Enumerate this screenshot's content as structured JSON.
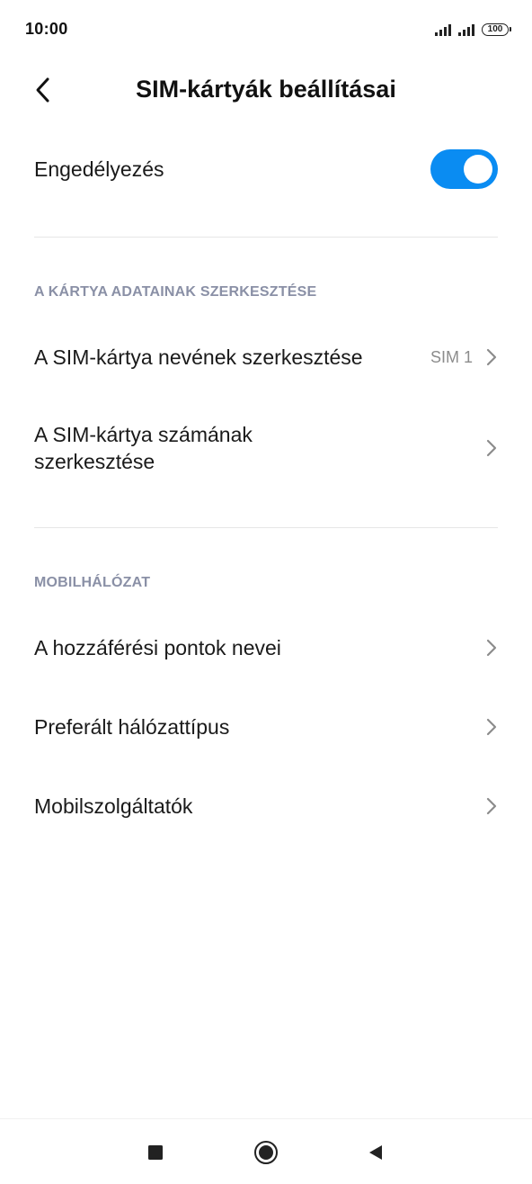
{
  "status_bar": {
    "time": "10:00",
    "battery_level": "100",
    "signal_icons": [
      "signal-strength-icon",
      "signal-strength-icon"
    ]
  },
  "header": {
    "back_icon": "chevron-left-icon",
    "title": "SIM-kártyák beállításai"
  },
  "enable": {
    "label": "Engedélyezés",
    "toggled_on": true,
    "accent_color": "#0a8cf2"
  },
  "sections": {
    "card_data": {
      "header": "A KÁRTYA ADATAINAK SZERKESZTÉSE",
      "items": [
        {
          "label": "A SIM-kártya nevének szerkesztése",
          "value": "SIM 1"
        },
        {
          "label": "A SIM-kártya számának szerkesztése",
          "value": ""
        }
      ]
    },
    "mobile_network": {
      "header": "MOBILHÁLÓZAT",
      "items": [
        {
          "label": "A hozzáférési pontok nevei"
        },
        {
          "label": "Preferált hálózattípus"
        },
        {
          "label": "Mobilszolgáltatók"
        }
      ]
    }
  },
  "nav_bar": {
    "icons": [
      "recents-square-icon",
      "home-circle-icon",
      "back-triangle-icon"
    ]
  }
}
